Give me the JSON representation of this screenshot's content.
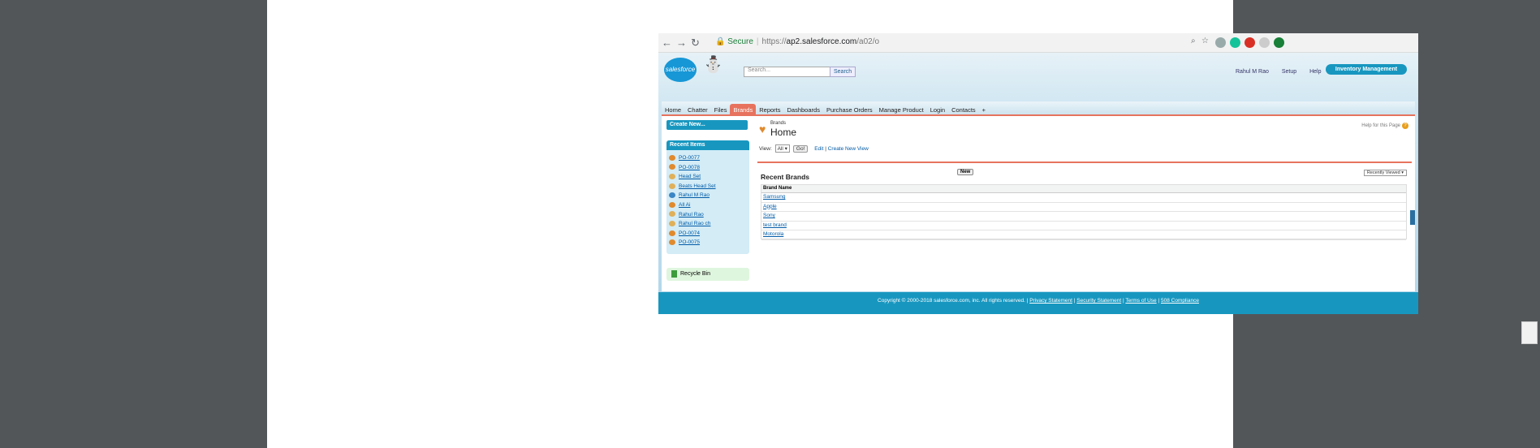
{
  "browser": {
    "url_prefix": "https://",
    "url_host": "ap2.salesforce.com",
    "url_path": "/a02/o",
    "secure_label": "Secure",
    "back": "←",
    "forward": "→",
    "reload": "↻"
  },
  "header": {
    "logo_text": "salesforce",
    "search_placeholder": "Search...",
    "search_button": "Search",
    "user_name": "Rahul M Rao",
    "setup": "Setup",
    "help": "Help",
    "app_menu": "Inventory Management"
  },
  "tabs": [
    "Home",
    "Chatter",
    "Files",
    "Brands",
    "Reports",
    "Dashboards",
    "Purchase Orders",
    "Manage Product",
    "Login",
    "Contacts",
    "+"
  ],
  "sidebar": {
    "create_new": "Create New...",
    "recent_title": "Recent Items",
    "recent_items": [
      {
        "label": "PO-0077",
        "icon": "heart-icon"
      },
      {
        "label": "PO-0078",
        "icon": "heart-icon"
      },
      {
        "label": "Head Set",
        "icon": "product-icon"
      },
      {
        "label": "Beats Head Set",
        "icon": "product-icon"
      },
      {
        "label": "Rahul M Rao",
        "icon": "person-icon"
      },
      {
        "label": "All Ai",
        "icon": "heart-icon"
      },
      {
        "label": "Rahul Rao",
        "icon": "login-icon"
      },
      {
        "label": "Rahul Rao ch",
        "icon": "login-icon"
      },
      {
        "label": "PO-0074",
        "icon": "heart-icon"
      },
      {
        "label": "PO-0075",
        "icon": "heart-icon"
      }
    ],
    "recycle_bin": "Recycle Bin"
  },
  "main": {
    "crumb": "Brands",
    "title": "Home",
    "help_link": "Help for this Page",
    "view_label": "View:",
    "view_value": "All",
    "go_button": "Go!",
    "edit_link": "Edit",
    "create_view_link": "Create New View",
    "recent_title": "Recent Brands",
    "new_button": "New",
    "recently_viewed": "Recently Viewed",
    "column_header": "Brand Name",
    "rows": [
      "Samsung",
      "Apple",
      "Sony",
      "test brand",
      "Motorola"
    ]
  },
  "footer": {
    "copyright": "Copyright © 2000-2018 salesforce.com, inc. All rights reserved.",
    "privacy": "Privacy Statement",
    "security": "Security Statement",
    "terms": "Terms of Use",
    "compliance": "508 Compliance"
  }
}
